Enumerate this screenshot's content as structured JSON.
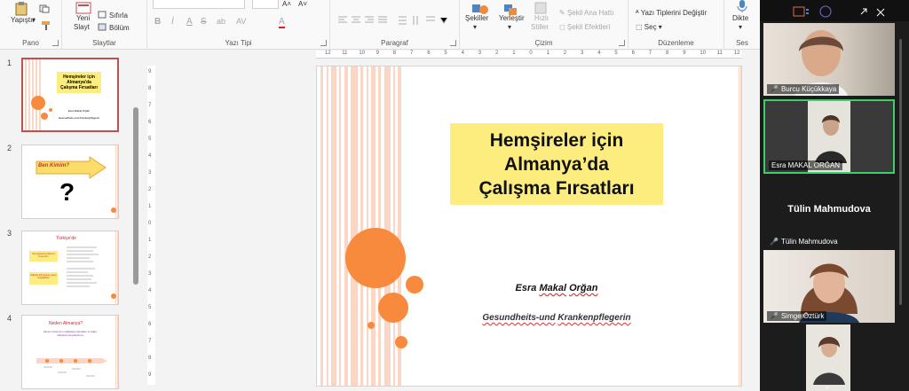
{
  "ribbon": {
    "pano": {
      "paste": "Yapıştır",
      "label": "Pano"
    },
    "slaytlar": {
      "new_slide_1": "Yeni",
      "new_slide_2": "Slayt",
      "reset": "Sıfırla",
      "section": "Bölüm",
      "label": "Slaytlar"
    },
    "yazi_tipi": {
      "label": "Yazı Tipi",
      "bold": "B",
      "italic": "İ",
      "underline": "A",
      "strike": "S",
      "shadow": "ab",
      "spacing": "AV",
      "color": "A"
    },
    "paragraf": {
      "label": "Paragraf"
    },
    "cizim": {
      "shapes": "Şekiller",
      "arrange": "Yerleştir",
      "quick_styles_1": "Hızlı",
      "quick_styles_2": "Stiller",
      "outline": "Şekil Ana Hattı",
      "effects": "Şekil Efektleri",
      "label": "Çizim"
    },
    "duzenleme": {
      "replace": "Yazı Tiplerini Değiştir",
      "select": "Seç",
      "label": "Düzenleme"
    },
    "ses": {
      "dictate": "Dikte",
      "label": "Ses"
    }
  },
  "slides": {
    "numbers": [
      "1",
      "2",
      "3",
      "4"
    ],
    "thumb1": {
      "title_1": "Hemşireler için",
      "title_2": "Almanya'da",
      "title_3": "Çalışma Fırsatları",
      "author": "Esra Makal Orğan",
      "profession": "Gesundheits-und Krankenpflegerin"
    },
    "thumb2": {
      "arrow_text": "Ben Kimim?",
      "glyph": "?"
    },
    "thumb3": {
      "title": "Türkiye'de",
      "box1": "Hemşirelerimiz Mevcut Durumları",
      "box2": "Sağlıkta Dönüşümle Gelen Değişiklikler"
    },
    "thumb4": {
      "title": "Neden Almanya?",
      "body": "Alman sisteminin sağladığı olanaklar ve diğer ülkelerle karşılaştırma"
    }
  },
  "rulers": {
    "h": [
      "12",
      "11",
      "10",
      "9",
      "8",
      "7",
      "6",
      "5",
      "4",
      "3",
      "2",
      "1",
      "0",
      "1",
      "2",
      "3",
      "4",
      "5",
      "6",
      "7",
      "8",
      "9",
      "10",
      "11",
      "12"
    ],
    "v": [
      "9",
      "8",
      "7",
      "6",
      "5",
      "4",
      "3",
      "2",
      "1",
      "0",
      "1",
      "2",
      "3",
      "4",
      "5",
      "6",
      "7",
      "8",
      "9"
    ]
  },
  "slide": {
    "title_1": "Hemşireler için",
    "title_2": "Almanya’da",
    "title_3": "Çalışma Fırsatları",
    "author_first": "Esra",
    "author_mid": "Makal",
    "author_last": "Orğan",
    "profession_1": "Gesundheits-und",
    "profession_2": "Krankenpflegerin",
    "accent": "#f88a3e",
    "stripe": "#fbd6c4"
  },
  "video": {
    "participants": [
      {
        "name": "Burcu Küçükkaya"
      },
      {
        "name": "Esra MAKAL ORĞAN"
      },
      {
        "name": "Tülin Mahmudova",
        "big_name": "Tülin Mahmudova"
      },
      {
        "name": "Simge Öztürk"
      },
      {
        "name": ""
      }
    ]
  }
}
